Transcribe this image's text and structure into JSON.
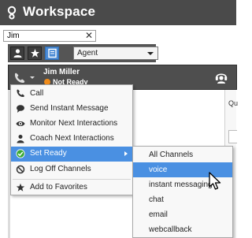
{
  "app": {
    "title": "Workspace"
  },
  "search": {
    "value": "Jim",
    "clear_glyph": "✕"
  },
  "toolbar": {
    "buttons": [
      {
        "icon": "person-icon"
      },
      {
        "icon": "star-icon"
      },
      {
        "icon": "contacts-icon",
        "active": true
      }
    ],
    "agent_select": {
      "value": "Agent"
    }
  },
  "agent_bar": {
    "name": "Jim Miller",
    "status": "Not Ready",
    "status_color": "#f08c1a"
  },
  "right_panel": {
    "edge_text": "Qu"
  },
  "context_menu": {
    "items": [
      {
        "label": "Call",
        "icon": "phone-icon"
      },
      {
        "label": "Send Instant Message",
        "icon": "chat-bubble-icon"
      },
      {
        "label": "Monitor Next Interactions",
        "icon": "eye-icon"
      },
      {
        "label": "Coach Next Interactions",
        "icon": "coach-icon"
      },
      {
        "label": "Set Ready",
        "icon": "ready-icon",
        "highlighted": true,
        "has_submenu": true
      },
      {
        "label": "Log Off Channels",
        "icon": "logoff-icon"
      },
      {
        "label": "Add to Favorites",
        "icon": "star-icon"
      }
    ]
  },
  "submenu": {
    "items": [
      {
        "label": "All Channels"
      },
      {
        "label": "voice",
        "highlighted": true
      },
      {
        "label": "instant messaging"
      },
      {
        "label": "chat"
      },
      {
        "label": "email"
      },
      {
        "label": "webcallback"
      }
    ]
  },
  "colors": {
    "titlebar": "#4a4a4a",
    "highlight": "#4a90e2",
    "ready_green": "#3aa935",
    "not_ready_orange": "#f08c1a"
  }
}
